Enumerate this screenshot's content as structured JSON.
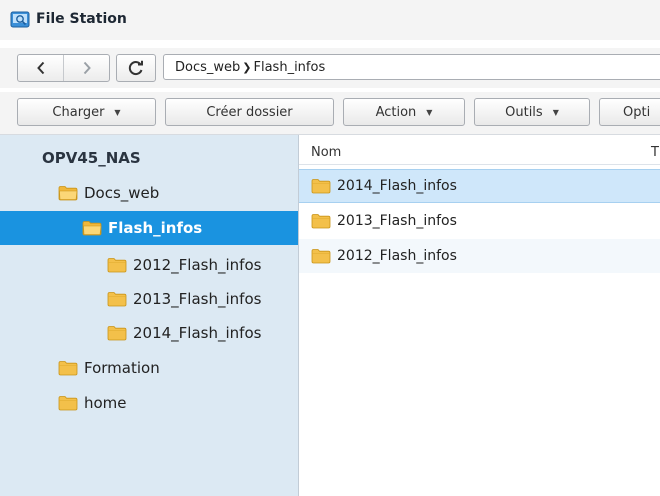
{
  "window": {
    "title": "File Station"
  },
  "nav": {
    "path": [
      "Docs_web",
      "Flash_infos"
    ]
  },
  "toolbar": {
    "charger": "Charger",
    "creer_dossier": "Créer dossier",
    "action": "Action",
    "outils": "Outils",
    "options": "Opti"
  },
  "tree": {
    "root": "OPV45_NAS",
    "items": [
      {
        "label": "Docs_web"
      },
      {
        "label": "Flash_infos"
      },
      {
        "label": "2012_Flash_infos"
      },
      {
        "label": "2013_Flash_infos"
      },
      {
        "label": "2014_Flash_infos"
      },
      {
        "label": "Formation"
      },
      {
        "label": "home"
      }
    ]
  },
  "list": {
    "columns": [
      "Nom",
      "T"
    ],
    "rows": [
      {
        "name": "2014_Flash_infos"
      },
      {
        "name": "2013_Flash_infos"
      },
      {
        "name": "2012_Flash_infos"
      }
    ]
  },
  "colors": {
    "selected_tree": "#1a93e0",
    "tree_bg": "#dce9f3",
    "folder": "#f3c04a"
  }
}
